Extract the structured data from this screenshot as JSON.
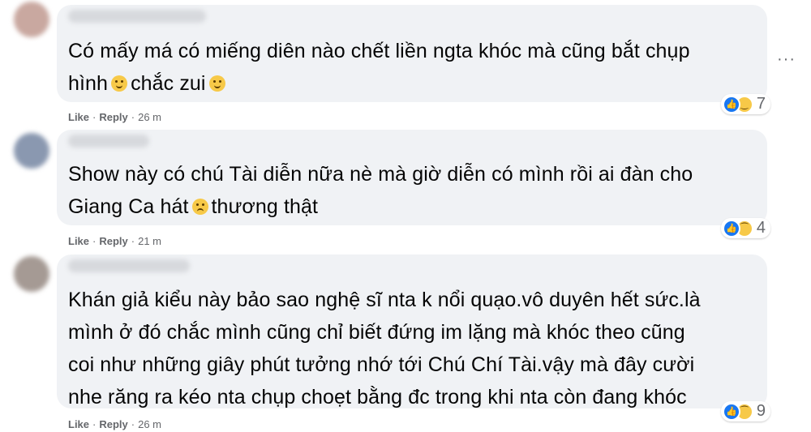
{
  "comments": [
    {
      "lines": [
        "Có mấy má có miếng diên nào chết liền ngta khóc mà cũng bắt chụp",
        "hình",
        "chắc zui"
      ],
      "reaction_count": "7",
      "actions": {
        "like": "Like",
        "reply": "Reply",
        "time": "26 m"
      },
      "reactions": [
        "like",
        "haha"
      ]
    },
    {
      "lines": [
        "Show này có chú Tài diễn nữa nè mà giờ diễn có mình rồi ai đàn cho",
        "Giang Ca hát",
        "thương thật"
      ],
      "reaction_count": "4",
      "actions": {
        "like": "Like",
        "reply": "Reply",
        "time": "21 m"
      },
      "reactions": [
        "like",
        "sad"
      ]
    },
    {
      "lines": [
        "Khán giả kiểu này bảo sao nghệ sĩ nta k nổi quạo.vô duyên hết sức.là",
        "mình ở đó chắc mình cũng chỉ biết đứng im lặng mà khóc theo cũng",
        "coi như những giây phút tưởng nhớ tới Chú Chí Tài.vậy mà đây cười",
        "nhe răng ra kéo nta chụp choẹt bằng đc trong khi nta còn đang khóc"
      ],
      "reaction_count": "9",
      "actions": {
        "like": "Like",
        "reply": "Reply",
        "time": "26 m"
      },
      "reactions": [
        "like",
        "sad"
      ]
    }
  ],
  "more_glyph": "···",
  "separator": "·",
  "colors": {
    "bubble": "#f0f2f5",
    "like": "#1877f2",
    "meta": "#65676b"
  }
}
